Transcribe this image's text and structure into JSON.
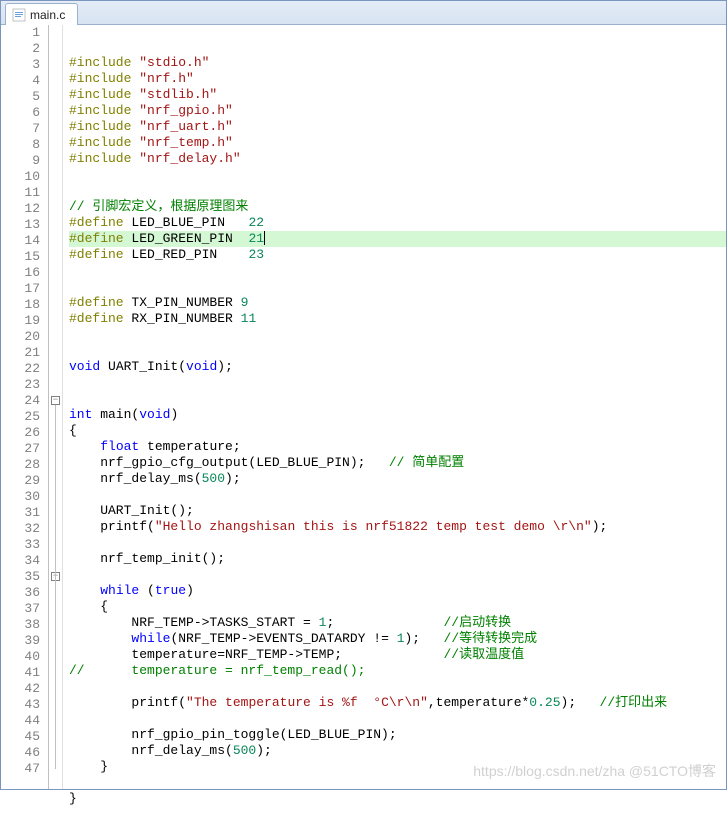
{
  "tab": {
    "label": "main.c"
  },
  "highlighted_line": 12,
  "watermark": "https://blog.csdn.net/zha @51CTO博客",
  "code_lines": [
    {
      "n": 1,
      "tokens": [
        [
          "pp",
          "#include "
        ],
        [
          "str",
          "\"stdio.h\""
        ]
      ]
    },
    {
      "n": 2,
      "tokens": [
        [
          "pp",
          "#include "
        ],
        [
          "str",
          "\"nrf.h\""
        ]
      ]
    },
    {
      "n": 3,
      "tokens": [
        [
          "pp",
          "#include "
        ],
        [
          "str",
          "\"stdlib.h\""
        ]
      ]
    },
    {
      "n": 4,
      "tokens": [
        [
          "pp",
          "#include "
        ],
        [
          "str",
          "\"nrf_gpio.h\""
        ]
      ]
    },
    {
      "n": 5,
      "tokens": [
        [
          "pp",
          "#include "
        ],
        [
          "str",
          "\"nrf_uart.h\""
        ]
      ]
    },
    {
      "n": 6,
      "tokens": [
        [
          "pp",
          "#include "
        ],
        [
          "str",
          "\"nrf_temp.h\""
        ]
      ]
    },
    {
      "n": 7,
      "tokens": [
        [
          "pp",
          "#include "
        ],
        [
          "str",
          "\"nrf_delay.h\""
        ]
      ]
    },
    {
      "n": 8,
      "tokens": []
    },
    {
      "n": 9,
      "tokens": []
    },
    {
      "n": 10,
      "tokens": [
        [
          "cmt",
          "// 引脚宏定义，根据原理图来"
        ]
      ]
    },
    {
      "n": 11,
      "tokens": [
        [
          "pp",
          "#define"
        ],
        [
          "",
          " LED_BLUE_PIN   "
        ],
        [
          "num",
          "22"
        ]
      ]
    },
    {
      "n": 12,
      "tokens": [
        [
          "pp",
          "#define"
        ],
        [
          "",
          " LED_GREEN_PIN  "
        ],
        [
          "num",
          "21"
        ]
      ]
    },
    {
      "n": 13,
      "tokens": [
        [
          "pp",
          "#define"
        ],
        [
          "",
          " LED_RED_PIN    "
        ],
        [
          "num",
          "23"
        ]
      ]
    },
    {
      "n": 14,
      "tokens": []
    },
    {
      "n": 15,
      "tokens": []
    },
    {
      "n": 16,
      "tokens": [
        [
          "pp",
          "#define"
        ],
        [
          "",
          " TX_PIN_NUMBER "
        ],
        [
          "num",
          "9"
        ]
      ]
    },
    {
      "n": 17,
      "tokens": [
        [
          "pp",
          "#define"
        ],
        [
          "",
          " RX_PIN_NUMBER "
        ],
        [
          "num",
          "11"
        ]
      ]
    },
    {
      "n": 18,
      "tokens": []
    },
    {
      "n": 19,
      "tokens": []
    },
    {
      "n": 20,
      "tokens": [
        [
          "kw",
          "void"
        ],
        [
          "",
          " UART_Init("
        ],
        [
          "kw",
          "void"
        ],
        [
          "",
          ");"
        ]
      ]
    },
    {
      "n": 21,
      "tokens": []
    },
    {
      "n": 22,
      "tokens": []
    },
    {
      "n": 23,
      "tokens": [
        [
          "kw",
          "int"
        ],
        [
          "",
          " main("
        ],
        [
          "kw",
          "void"
        ],
        [
          "",
          ")"
        ]
      ]
    },
    {
      "n": 24,
      "tokens": [
        [
          "",
          "{"
        ]
      ],
      "fold": "open"
    },
    {
      "n": 25,
      "tokens": [
        [
          "",
          "    "
        ],
        [
          "kw",
          "float"
        ],
        [
          "",
          " temperature;"
        ]
      ]
    },
    {
      "n": 26,
      "tokens": [
        [
          "",
          "    nrf_gpio_cfg_output(LED_BLUE_PIN);   "
        ],
        [
          "cmt",
          "// 简单配置"
        ]
      ]
    },
    {
      "n": 27,
      "tokens": [
        [
          "",
          "    nrf_delay_ms("
        ],
        [
          "num",
          "500"
        ],
        [
          "",
          ");"
        ]
      ]
    },
    {
      "n": 28,
      "tokens": []
    },
    {
      "n": 29,
      "tokens": [
        [
          "",
          "    UART_Init();"
        ]
      ]
    },
    {
      "n": 30,
      "tokens": [
        [
          "",
          "    printf("
        ],
        [
          "str",
          "\"Hello zhangshisan this is nrf51822 temp test demo \\r\\n\""
        ],
        [
          "",
          ");"
        ]
      ]
    },
    {
      "n": 31,
      "tokens": []
    },
    {
      "n": 32,
      "tokens": [
        [
          "",
          "    nrf_temp_init();"
        ]
      ]
    },
    {
      "n": 33,
      "tokens": []
    },
    {
      "n": 34,
      "tokens": [
        [
          "",
          "    "
        ],
        [
          "kw",
          "while"
        ],
        [
          "",
          " ("
        ],
        [
          "kw",
          "true"
        ],
        [
          "",
          ")"
        ]
      ]
    },
    {
      "n": 35,
      "tokens": [
        [
          "",
          "    {"
        ]
      ],
      "fold": "open"
    },
    {
      "n": 36,
      "tokens": [
        [
          "",
          "        NRF_TEMP->TASKS_START = "
        ],
        [
          "num",
          "1"
        ],
        [
          "",
          ";              "
        ],
        [
          "cmt",
          "//启动转换"
        ]
      ]
    },
    {
      "n": 37,
      "tokens": [
        [
          "",
          "        "
        ],
        [
          "kw",
          "while"
        ],
        [
          "",
          "(NRF_TEMP->EVENTS_DATARDY != "
        ],
        [
          "num",
          "1"
        ],
        [
          "",
          ");   "
        ],
        [
          "cmt",
          "//等待转换完成"
        ]
      ]
    },
    {
      "n": 38,
      "tokens": [
        [
          "",
          "        temperature=NRF_TEMP->TEMP;             "
        ],
        [
          "cmt",
          "//读取温度值"
        ]
      ]
    },
    {
      "n": 39,
      "tokens": [
        [
          "cmt",
          "//      temperature = nrf_temp_read();"
        ]
      ]
    },
    {
      "n": 40,
      "tokens": []
    },
    {
      "n": 41,
      "tokens": [
        [
          "",
          "        printf("
        ],
        [
          "str",
          "\"The temperature is %f  °C\\r\\n\""
        ],
        [
          "",
          ",temperature*"
        ],
        [
          "num",
          "0.25"
        ],
        [
          "",
          ");   "
        ],
        [
          "cmt",
          "//打印出来"
        ]
      ]
    },
    {
      "n": 42,
      "tokens": []
    },
    {
      "n": 43,
      "tokens": [
        [
          "",
          "        nrf_gpio_pin_toggle(LED_BLUE_PIN);"
        ]
      ]
    },
    {
      "n": 44,
      "tokens": [
        [
          "",
          "        nrf_delay_ms("
        ],
        [
          "num",
          "500"
        ],
        [
          "",
          ");"
        ]
      ]
    },
    {
      "n": 45,
      "tokens": [
        [
          "",
          "    }"
        ]
      ]
    },
    {
      "n": 46,
      "tokens": []
    },
    {
      "n": 47,
      "tokens": [
        [
          "",
          "}"
        ]
      ]
    }
  ]
}
